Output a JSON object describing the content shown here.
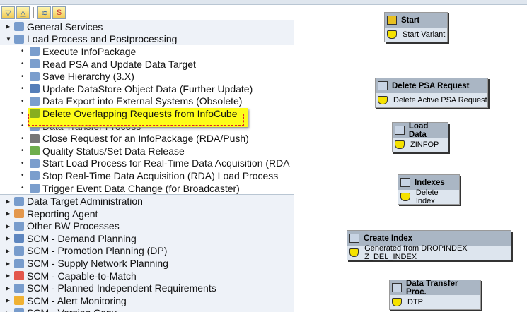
{
  "toolbar": {
    "buttons": [
      "expand-all",
      "collapse-all",
      "process-types",
      "scheduler"
    ]
  },
  "tree": [
    {
      "label": "General Services",
      "level": 0,
      "state": "collapsed",
      "icon": "services-icon"
    },
    {
      "label": "Load Process and Postprocessing",
      "level": 0,
      "state": "expanded",
      "icon": "load-process-icon"
    },
    {
      "label": "Execute InfoPackage",
      "level": 1,
      "icon": "infopackage-icon"
    },
    {
      "label": "Read PSA and Update Data Target",
      "level": 1,
      "icon": "read-psa-icon"
    },
    {
      "label": "Save Hierarchy (3.X)",
      "level": 1,
      "icon": "hierarchy-icon"
    },
    {
      "label": "Update DataStore Object Data (Further Update)",
      "level": 1,
      "icon": "gear-icon"
    },
    {
      "label": "Data Export into External Systems (Obsolete)",
      "level": 1,
      "icon": "export-icon"
    },
    {
      "label": "Delete Overlapping Requests from InfoCube",
      "level": 1,
      "icon": "trash-icon",
      "highlighted": true
    },
    {
      "label": "Data Transfer Process",
      "level": 1,
      "icon": "dtp-icon"
    },
    {
      "label": "Close Request for an InfoPackage (RDA/Push)",
      "level": 1,
      "icon": "flag-icon"
    },
    {
      "label": "Quality Status/Set Data Release",
      "level": 1,
      "icon": "green-flag-icon"
    },
    {
      "label": "Start Load Process for Real-Time Data Acquisition (RDA",
      "level": 1,
      "icon": "start-rda-icon"
    },
    {
      "label": "Stop Real-Time Data Acquisition (RDA) Load Process",
      "level": 1,
      "icon": "stop-rda-icon"
    },
    {
      "label": "Trigger Event Data Change (for Broadcaster)",
      "level": 1,
      "icon": "trigger-icon"
    },
    {
      "label": "Data Target Administration",
      "level": 0,
      "state": "collapsed",
      "icon": "target-icon"
    },
    {
      "label": "Reporting Agent",
      "level": 0,
      "state": "collapsed",
      "icon": "agent-icon"
    },
    {
      "label": "Other BW Processes",
      "level": 0,
      "state": "collapsed",
      "icon": "processes-icon"
    },
    {
      "label": "SCM - Demand Planning",
      "level": 0,
      "state": "collapsed",
      "icon": "chart-icon"
    },
    {
      "label": "SCM - Promotion Planning (DP)",
      "level": 0,
      "state": "collapsed",
      "icon": "promotion-icon"
    },
    {
      "label": "SCM - Supply Network Planning",
      "level": 0,
      "state": "collapsed",
      "icon": "network-icon"
    },
    {
      "label": "SCM - Capable-to-Match",
      "level": 0,
      "state": "collapsed",
      "icon": "ctm-icon"
    },
    {
      "label": "SCM - Planned Independent Requirements",
      "level": 0,
      "state": "collapsed",
      "icon": "requirements-icon"
    },
    {
      "label": "SCM - Alert Monitoring",
      "level": 0,
      "state": "collapsed",
      "icon": "alert-icon"
    },
    {
      "label": "SCM - Version Copy",
      "level": 0,
      "state": "collapsed",
      "icon": "copy-icon"
    }
  ],
  "nodes": [
    {
      "title": "Start",
      "variant": "Start Variant"
    },
    {
      "title": "Delete PSA Request",
      "variant": "Delete Active PSA Request"
    },
    {
      "title": "Load Data",
      "variant": "ZINFOP"
    },
    {
      "title": "Indexes",
      "variant": "Delete Index"
    },
    {
      "title": "Create Index",
      "variant": "Generated from DROPINDEX Z_DEL_INDEX"
    },
    {
      "title": "Data Transfer Proc.",
      "variant": "DTP"
    }
  ],
  "colors": {
    "highlight": "#fdfd1a",
    "node_header": "#aab6c4",
    "node_body": "#dde5ee"
  }
}
